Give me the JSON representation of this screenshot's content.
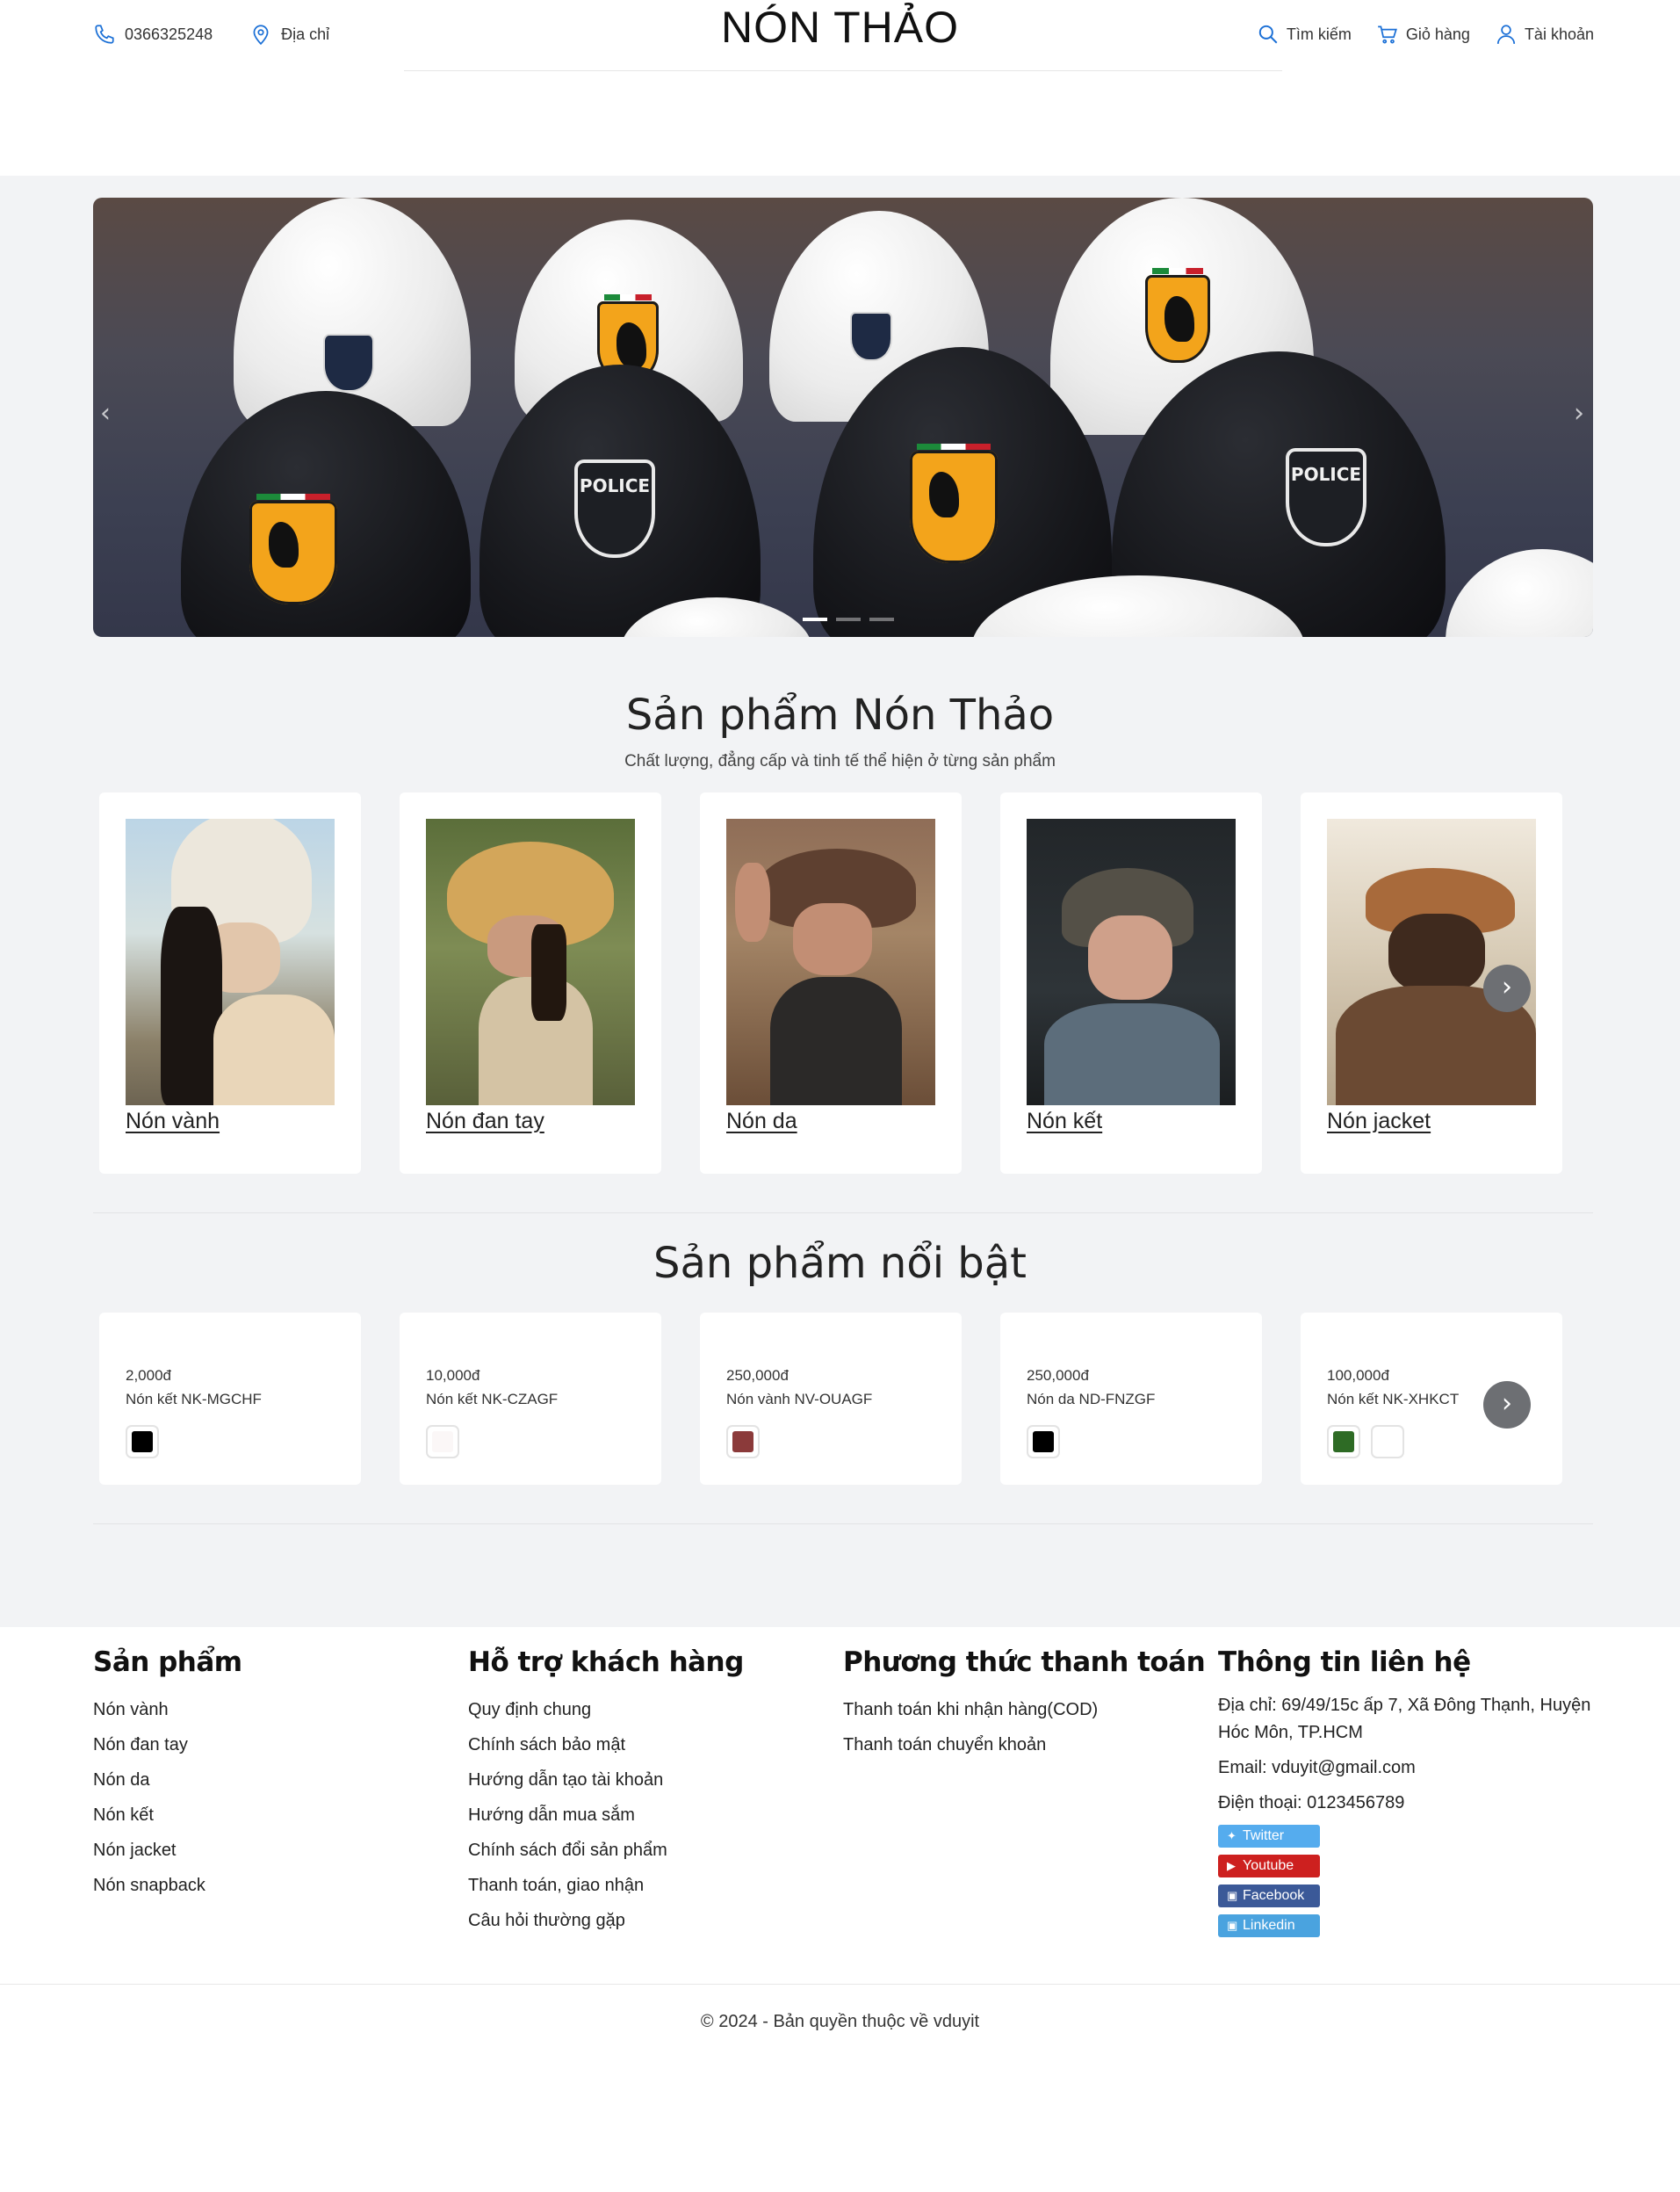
{
  "header": {
    "phone": "0366325248",
    "address_label": "Địa chỉ",
    "brand": "NÓN THẢO",
    "search_label": "Tìm kiếm",
    "cart_label": "Giỏ hàng",
    "account_label": "Tài khoản",
    "accent_color": "#1a6fd6"
  },
  "banner": {
    "prev_icon": "chevron-left-icon",
    "next_icon": "chevron-right-icon",
    "slide_count": 3,
    "active_slide": 1,
    "prev_glyph": "‹",
    "next_glyph": "›"
  },
  "categories_section": {
    "title": "Sản phẩm Nón Thảo",
    "subtitle": "Chất lượng, đẳng cấp và tinh tế thể hiện ở từng sản phẩm",
    "items": [
      {
        "label": "Nón vành"
      },
      {
        "label": "Nón đan tay"
      },
      {
        "label": "Nón da"
      },
      {
        "label": "Nón kết"
      },
      {
        "label": "Nón jacket"
      }
    ],
    "next_glyph": "›"
  },
  "featured_section": {
    "title": "Sản phẩm nổi bật",
    "items": [
      {
        "price": "2,000đ",
        "name": "Nón kết NK-MGCHF",
        "colors": [
          "#000000"
        ]
      },
      {
        "price": "10,000đ",
        "name": "Nón kết NK-CZAGF",
        "colors": [
          "#fbf7f7"
        ]
      },
      {
        "price": "250,000đ",
        "name": "Nón vành NV-OUAGF",
        "colors": [
          "#8b3a3a"
        ]
      },
      {
        "price": "250,000đ",
        "name": "Nón da ND-FNZGF",
        "colors": [
          "#000000"
        ]
      },
      {
        "price": "100,000đ",
        "name": "Nón kết NK-XHKCT",
        "colors": [
          "#2e6b25",
          "#ffffff"
        ]
      }
    ],
    "next_glyph": "›"
  },
  "footer": {
    "products": {
      "title": "Sản phẩm",
      "links": [
        "Nón vành",
        "Nón đan tay",
        "Nón da",
        "Nón kết",
        "Nón jacket",
        "Nón snapback"
      ]
    },
    "support": {
      "title": "Hỗ trợ khách hàng",
      "links": [
        "Quy định chung",
        "Chính sách bảo mật",
        "Hướng dẫn tạo tài khoản",
        "Hướng dẫn mua sắm",
        "Chính sách đổi sản phẩm",
        "Thanh toán, giao nhận",
        "Câu hỏi thường gặp"
      ]
    },
    "payment": {
      "title": "Phương thức thanh toán",
      "links": [
        "Thanh toán khi nhận hàng(COD)",
        "Thanh toán chuyển khoản"
      ]
    },
    "contact": {
      "title": "Thông tin liên hệ",
      "address": "Địa chỉ: 69/49/15c ấp 7, Xã Đông Thạnh, Huyện Hóc Môn, TP.HCM",
      "email": "Email: vduyit@gmail.com",
      "phone": "Điện thoại: 0123456789",
      "socials": [
        {
          "label": "Twitter",
          "color": "#55acee"
        },
        {
          "label": "Youtube",
          "color": "#cd201f"
        },
        {
          "label": "Facebook",
          "color": "#3b5998"
        },
        {
          "label": "Linkedin",
          "color": "#4aa3df"
        }
      ]
    },
    "copyright": "© 2024 - Bản quyền thuộc về vduyit"
  }
}
